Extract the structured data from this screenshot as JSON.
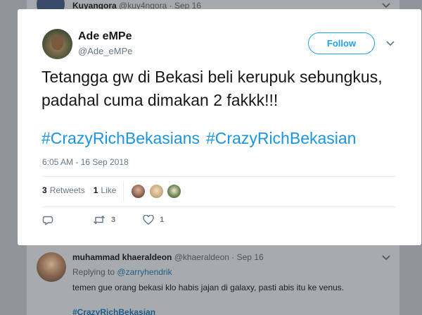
{
  "background": {
    "top_tweet": {
      "name": "Kuyangora",
      "handle": "@kuy4ngora",
      "date": "· Sep 16"
    },
    "reply": {
      "name": "muhammad khaeraldeon",
      "handle": "@khaeraldeon",
      "date": "· Sep 16",
      "replying_label": "Replying to",
      "replying_handle": "@zarryhendrik",
      "text": "temen gue orang bekasi klo habis jajan di galaxy, pasti abis itu ke venus.",
      "hashtag": "#CrazyRichBekasian"
    }
  },
  "tweet": {
    "display_name": "Ade eMPe",
    "handle": "@Ade_eMPe",
    "follow_label": "Follow",
    "text": "Tetangga gw di Bekasi beli kerupuk sebungkus, padahal cuma dimakan 2 fakkk!!!",
    "hashtags": [
      "#CrazyRichBekasians",
      "#CrazyRichBekasian"
    ],
    "timestamp": "6:05 AM - 16 Sep 2018",
    "stats": {
      "retweets_count": "3",
      "retweets_label": "Retweets",
      "likes_count": "1",
      "likes_label": "Like"
    },
    "actions": {
      "reply_count": "",
      "retweet_count": "3",
      "like_count": "1"
    }
  },
  "icons": {
    "more": "chevron-down-icon",
    "reply": "reply-icon",
    "retweet": "retweet-icon",
    "like": "heart-icon"
  },
  "colors": {
    "accent": "#1da1f2",
    "hashtag": "#1b95e0",
    "muted": "#657786",
    "overlay": "#8f959a"
  }
}
